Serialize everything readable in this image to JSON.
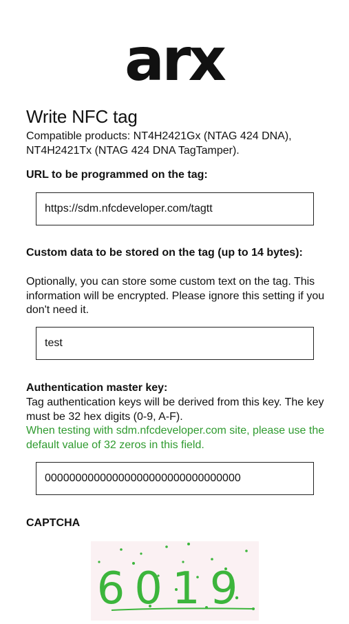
{
  "logo": {
    "text": "arx"
  },
  "page": {
    "title": "Write NFC tag",
    "compatible": "Compatible products: NT4H2421Gx (NTAG 424 DNA), NT4H2421Tx (NTAG 424 DNA TagTamper)."
  },
  "url_section": {
    "label": "URL to be programmed on the tag:",
    "value": "https://sdm.nfcdeveloper.com/tagtt"
  },
  "custom_section": {
    "label": "Custom data to be stored on the tag (up to 14 bytes):",
    "description": "Optionally, you can store some custom text on the tag. This information will be encrypted. Please ignore this setting if you don't need it.",
    "value": "test"
  },
  "auth_section": {
    "label": "Authentication master key:",
    "description": "Tag authentication keys will be derived from this key. The key must be 32 hex digits (0-9, A-F).",
    "note": "When testing with sdm.nfcdeveloper.com site, please use the default value of 32 zeros in this field.",
    "value": "00000000000000000000000000000000"
  },
  "captcha": {
    "label": "CAPTCHA",
    "text": "6019"
  },
  "colors": {
    "note_green": "#2e9a2e",
    "captcha_bg": "#fbf1f3",
    "captcha_ink": "#3cb53c"
  }
}
